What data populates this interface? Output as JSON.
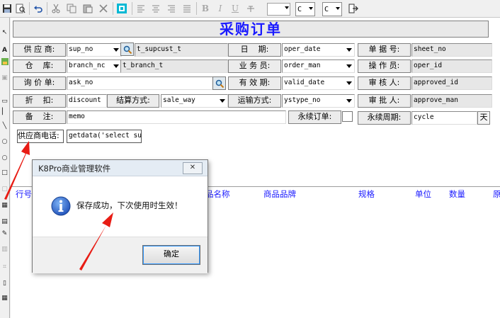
{
  "form": {
    "title": "采购订单",
    "rows": [
      {
        "label": "供 应 商:",
        "value": "sup_no",
        "value2": "t_supcust_t",
        "label2": "日    期:",
        "value3": "oper_date",
        "label3": "单 据 号:",
        "value4": "sheet_no"
      },
      {
        "label": "仓    库:",
        "value": "branch_nc",
        "value2": "t_branch_t",
        "label2": "业 务 员:",
        "value3": "order_man",
        "label3": "操 作 员:",
        "value4": "oper_id"
      },
      {
        "label": "询 价 单:",
        "value": "ask_no",
        "label2": "有 效 期:",
        "value3": "valid_date",
        "label3": "审 核 人:",
        "value4": "approved_id"
      },
      {
        "label": "折    扣:",
        "value": "discount",
        "label_mid": "结算方式:",
        "value2": "sale_way",
        "label2": "运输方式:",
        "value3": "ystype_no",
        "label3": "审 批 人:",
        "value4": "approve_man"
      },
      {
        "label": "备    注:",
        "value": "memo",
        "label2": "永续订单:",
        "label3": "永续周期:",
        "value4": "cycle",
        "button": "天"
      }
    ],
    "supplier_phone_label": "供应商电话:",
    "supplier_phone_value": "getdata('select su"
  },
  "grid": {
    "headers": [
      "行号",
      "品名称",
      "商品品牌",
      "规格",
      "单位",
      "数量",
      "原"
    ]
  },
  "dialog": {
    "title": "K8Pro商业管理软件",
    "message": "保存成功，下次使用时生效！",
    "ok_label": "确定",
    "close_label": "✕"
  },
  "toolbar": {
    "combo_c1": "C",
    "combo_c2": "C"
  },
  "colors": {
    "accent_blue": "#1a1aff",
    "annotation_red": "#e81c14",
    "info_icon_blue": "#1f5fcf"
  },
  "icons": [
    "save-icon",
    "preview-icon",
    "undo-icon",
    "cut-icon",
    "copy-icon",
    "paste-icon",
    "delete-icon",
    "select-all-icon",
    "align-left-icon",
    "align-center-icon",
    "align-right-icon",
    "justify-icon",
    "bold-icon",
    "italic-icon",
    "underline-icon",
    "strikethrough-icon",
    "exit-icon",
    "info-icon",
    "search-icon"
  ]
}
